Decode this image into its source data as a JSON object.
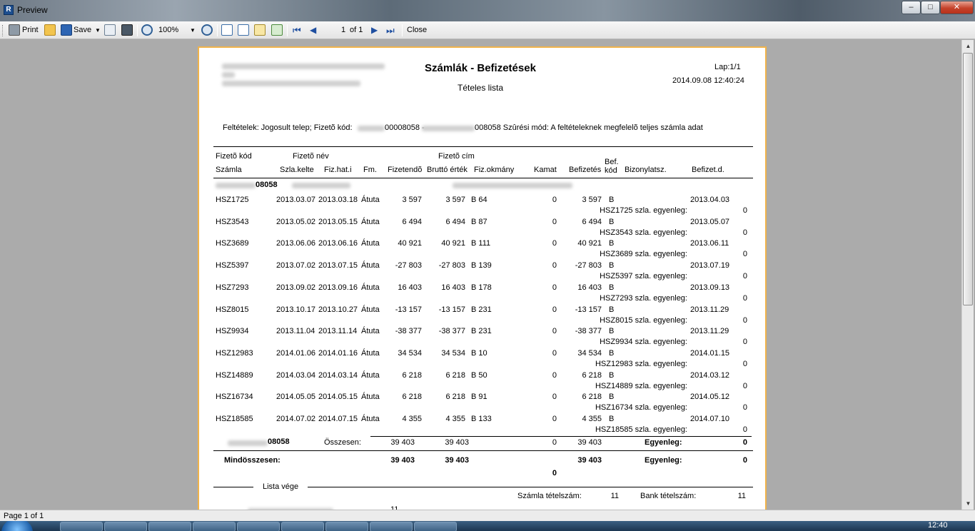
{
  "window": {
    "title": "Preview",
    "min_glyph": "–",
    "max_glyph": "□",
    "close_glyph": "✕"
  },
  "toolbar": {
    "print": "Print",
    "save": "Save",
    "zoom": "100%",
    "page_current": "1",
    "page_of": "of 1",
    "close": "Close"
  },
  "status": {
    "page_info": "Page 1 of 1"
  },
  "taskbar": {
    "clock": "12:40"
  },
  "report": {
    "title": "Számlák - Befizetések",
    "subtitle": "Tételes lista",
    "page_label": "Lap:1/1",
    "timestamp": "2014.09.08 12:40:24",
    "conditions_a": "Feltételek: Jogosult telep; Fizetõ kód:",
    "conditions_b": "00008058 -",
    "conditions_c": "008058 Szûrési mód: A feltételeknek megfelelõ teljes számla adat",
    "headers": {
      "payer_code": "Fizetõ kód",
      "payer_name": "Fizetõ név",
      "payer_addr": "Fizetõ cím",
      "invoice": "Számla",
      "issue_date": "Szla.kelte",
      "due_date": "Fiz.hat.i",
      "method": "Fm.",
      "payable": "Fizetendõ",
      "gross": "Bruttó érték",
      "pay_doc": "Fiz.okmány",
      "interest": "Kamat",
      "paid": "Befizetés",
      "bank_code": "Bef. kód",
      "voucher_no": "Bizonylatsz.",
      "paid_date": "Befizet.d."
    },
    "group_code": "08058",
    "rows": [
      {
        "inv": "HSZ1725",
        "kelte": "2013.03.07",
        "hat": "2013.03.18",
        "fm": "Átuta",
        "fiz": "3 597",
        "brutto": "3 597",
        "okm": "B 64",
        "kamat": "0",
        "bef": "3 597",
        "kod": "B",
        "befd": "2013.04.03",
        "egy_label": "HSZ1725 szla. egyenleg:",
        "egy": "0"
      },
      {
        "inv": "HSZ3543",
        "kelte": "2013.05.02",
        "hat": "2013.05.15",
        "fm": "Átuta",
        "fiz": "6 494",
        "brutto": "6 494",
        "okm": "B 87",
        "kamat": "0",
        "bef": "6 494",
        "kod": "B",
        "befd": "2013.05.07",
        "egy_label": "HSZ3543 szla. egyenleg:",
        "egy": "0"
      },
      {
        "inv": "HSZ3689",
        "kelte": "2013.06.06",
        "hat": "2013.06.16",
        "fm": "Átuta",
        "fiz": "40 921",
        "brutto": "40 921",
        "okm": "B 111",
        "kamat": "0",
        "bef": "40 921",
        "kod": "B",
        "befd": "2013.06.11",
        "egy_label": "HSZ3689 szla. egyenleg:",
        "egy": "0"
      },
      {
        "inv": "HSZ5397",
        "kelte": "2013.07.02",
        "hat": "2013.07.15",
        "fm": "Átuta",
        "fiz": "-27 803",
        "brutto": "-27 803",
        "okm": "B 139",
        "kamat": "0",
        "bef": "-27 803",
        "kod": "B",
        "befd": "2013.07.19",
        "egy_label": "HSZ5397 szla. egyenleg:",
        "egy": "0"
      },
      {
        "inv": "HSZ7293",
        "kelte": "2013.09.02",
        "hat": "2013.09.16",
        "fm": "Átuta",
        "fiz": "16 403",
        "brutto": "16 403",
        "okm": "B 178",
        "kamat": "0",
        "bef": "16 403",
        "kod": "B",
        "befd": "2013.09.13",
        "egy_label": "HSZ7293 szla. egyenleg:",
        "egy": "0"
      },
      {
        "inv": "HSZ8015",
        "kelte": "2013.10.17",
        "hat": "2013.10.27",
        "fm": "Átuta",
        "fiz": "-13 157",
        "brutto": "-13 157",
        "okm": "B 231",
        "kamat": "0",
        "bef": "-13 157",
        "kod": "B",
        "befd": "2013.11.29",
        "egy_label": "HSZ8015 szla. egyenleg:",
        "egy": "0"
      },
      {
        "inv": "HSZ9934",
        "kelte": "2013.11.04",
        "hat": "2013.11.14",
        "fm": "Átuta",
        "fiz": "-38 377",
        "brutto": "-38 377",
        "okm": "B 231",
        "kamat": "0",
        "bef": "-38 377",
        "kod": "B",
        "befd": "2013.11.29",
        "egy_label": "HSZ9934 szla. egyenleg:",
        "egy": "0"
      },
      {
        "inv": "HSZ12983",
        "kelte": "2014.01.06",
        "hat": "2014.01.16",
        "fm": "Átuta",
        "fiz": "34 534",
        "brutto": "34 534",
        "okm": "B 10",
        "kamat": "0",
        "bef": "34 534",
        "kod": "B",
        "befd": "2014.01.15",
        "egy_label": "HSZ12983 szla. egyenleg:",
        "egy": "0"
      },
      {
        "inv": "HSZ14889",
        "kelte": "2014.03.04",
        "hat": "2014.03.14",
        "fm": "Átuta",
        "fiz": "6 218",
        "brutto": "6 218",
        "okm": "B 50",
        "kamat": "0",
        "bef": "6 218",
        "kod": "B",
        "befd": "2014.03.12",
        "egy_label": "HSZ14889 szla. egyenleg:",
        "egy": "0"
      },
      {
        "inv": "HSZ16734",
        "kelte": "2014.05.05",
        "hat": "2014.05.15",
        "fm": "Átuta",
        "fiz": "6 218",
        "brutto": "6 218",
        "okm": "B 91",
        "kamat": "0",
        "bef": "6 218",
        "kod": "B",
        "befd": "2014.05.12",
        "egy_label": "HSZ16734 szla. egyenleg:",
        "egy": "0"
      },
      {
        "inv": "HSZ18585",
        "kelte": "2014.07.02",
        "hat": "2014.07.15",
        "fm": "Átuta",
        "fiz": "4 355",
        "brutto": "4 355",
        "okm": "B 133",
        "kamat": "0",
        "bef": "4 355",
        "kod": "B",
        "befd": "2014.07.10",
        "egy_label": "HSZ18585 szla. egyenleg:",
        "egy": "0"
      }
    ],
    "group_total": {
      "code": "08058",
      "label": "Összesen:",
      "fiz": "39 403",
      "brutto": "39 403",
      "kamat": "0",
      "bef": "39 403",
      "egy_label": "Egyenleg:",
      "egy": "0"
    },
    "grand_total": {
      "label": "Mindösszesen:",
      "fiz": "39 403",
      "brutto": "39 403",
      "kamat": "0",
      "bef": "39 403",
      "egy_label": "Egyenleg:",
      "egy": "0"
    },
    "footer": {
      "end_label": "Lista vége",
      "inv_count_label": "Számla tételszám:",
      "inv_count": "11",
      "bank_count_label": "Bank tételszám:",
      "bank_count": "11",
      "partial_value": "11"
    }
  }
}
